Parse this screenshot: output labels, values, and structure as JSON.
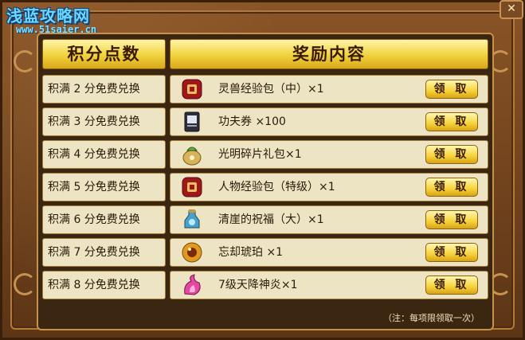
{
  "watermark": {
    "site_name": "浅蓝攻略网",
    "url": "www.51saier.cn"
  },
  "header": {
    "col_points": "积分点数",
    "col_rewards": "奖励内容"
  },
  "rows": [
    {
      "condition": "积满 2 分免费兑换",
      "reward": "灵兽经验包（中）×1",
      "button": "领 取",
      "icon": "red-pouch-icon"
    },
    {
      "condition": "积满 3 分免费兑换",
      "reward": "功夫券 ×100",
      "button": "领 取",
      "icon": "coupon-card-icon"
    },
    {
      "condition": "积满 4 分免费兑换",
      "reward": "光明碎片礼包×1",
      "button": "领 取",
      "icon": "gold-bag-icon"
    },
    {
      "condition": "积满 5 分免费兑换",
      "reward": "人物经验包（特级）×1",
      "button": "领 取",
      "icon": "red-pouch-icon"
    },
    {
      "condition": "积满 6 分免费兑换",
      "reward": "清崖的祝福（大）×1",
      "button": "领 取",
      "icon": "blessing-bottle-icon"
    },
    {
      "condition": "积满 7 分免费兑换",
      "reward": "忘却琥珀 ×1",
      "button": "领 取",
      "icon": "amber-ring-icon"
    },
    {
      "condition": "积满 8 分免费兑换",
      "reward": "7级天降神炎×1",
      "button": "领 取",
      "icon": "pink-flame-icon"
    }
  ],
  "footer_note": "（注：每项限领取一次）",
  "colors": {
    "header_gold": "#f0d23c",
    "row_bg": "#ede4c4",
    "frame_brown": "#6a3f1c"
  }
}
